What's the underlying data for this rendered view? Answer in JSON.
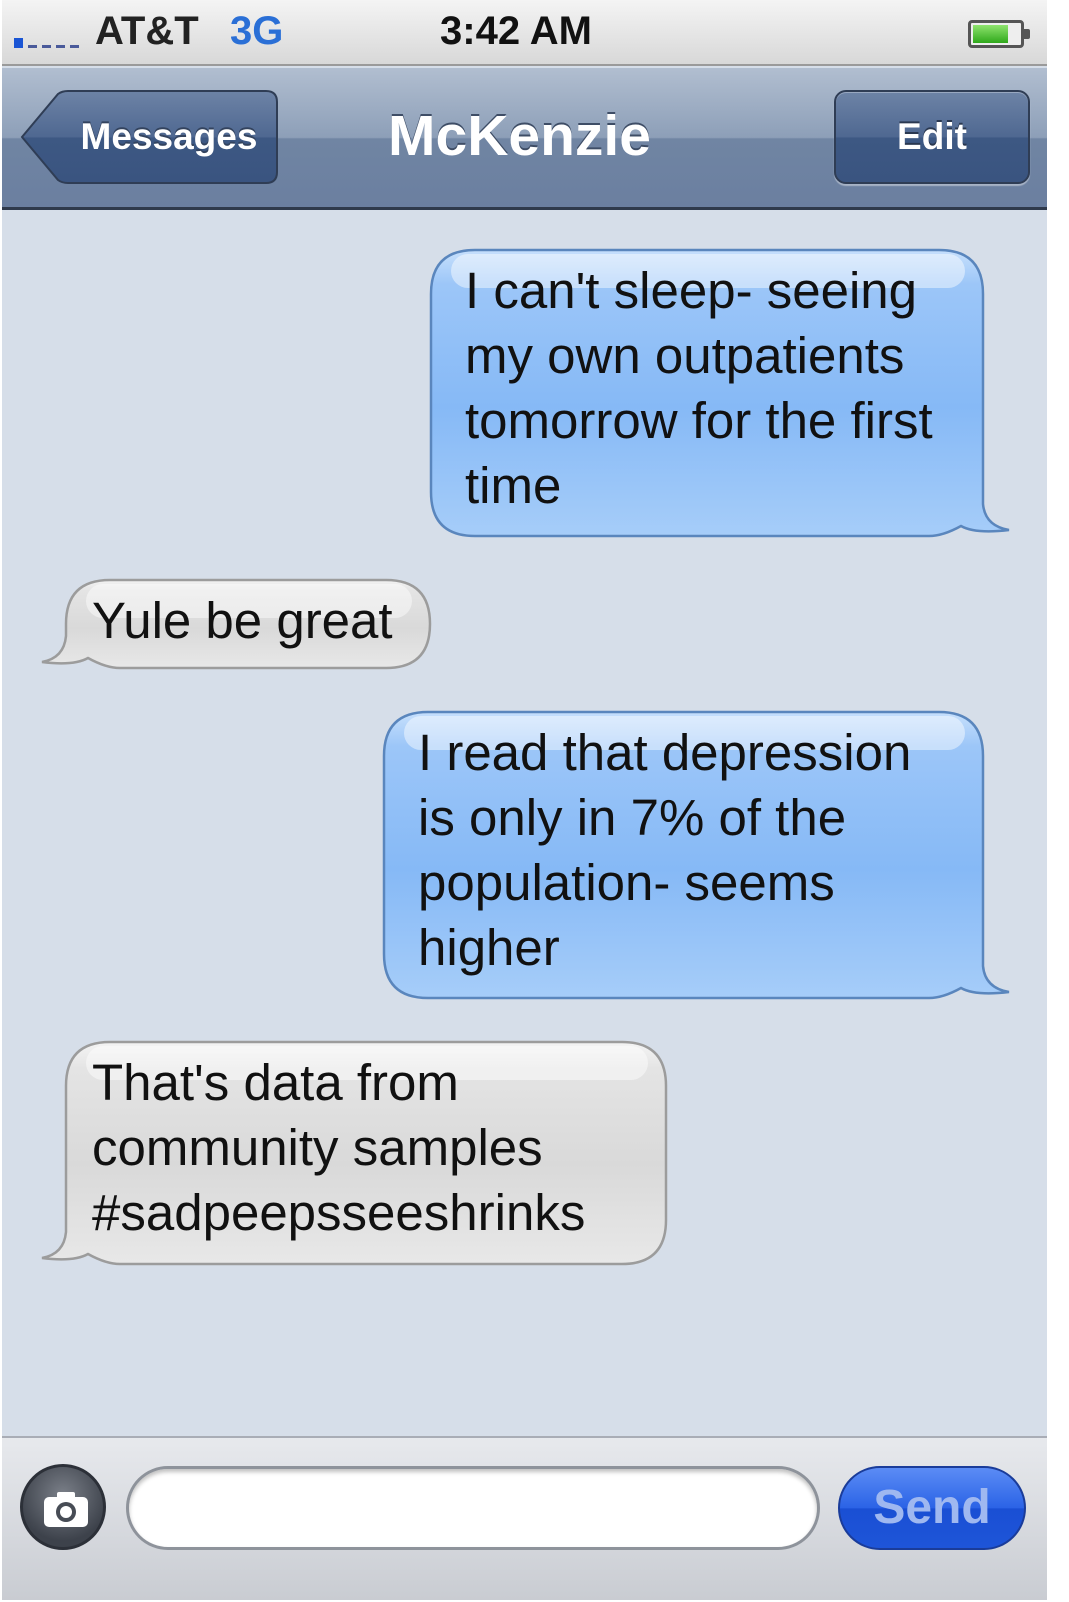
{
  "status_bar": {
    "carrier": "AT&T",
    "network": "3G",
    "time": "3:42 AM",
    "signal_bars": 1,
    "battery_level": 0.75
  },
  "nav": {
    "back_label": "Messages",
    "title": "McKenzie",
    "edit_label": "Edit"
  },
  "messages": [
    {
      "direction": "sent",
      "lines": [
        "I can't sleep-  seeing",
        "my own outpatients",
        "tomorrow for the first",
        "time"
      ]
    },
    {
      "direction": "received",
      "lines": [
        "Yule be great"
      ]
    },
    {
      "direction": "sent",
      "lines": [
        "I read that depression",
        "is only in 7% of the",
        "population- seems",
        "higher"
      ]
    },
    {
      "direction": "received",
      "lines": [
        "That's data from",
        "community samples",
        "#sadpeepsseeshrinks"
      ]
    }
  ],
  "compose": {
    "input_value": "",
    "send_label": "Send"
  },
  "colors": {
    "sent_bubble": "#8fbdf6",
    "received_bubble": "#e2e2e2",
    "background": "#d6dee9",
    "send_button": "#2b63e6"
  }
}
